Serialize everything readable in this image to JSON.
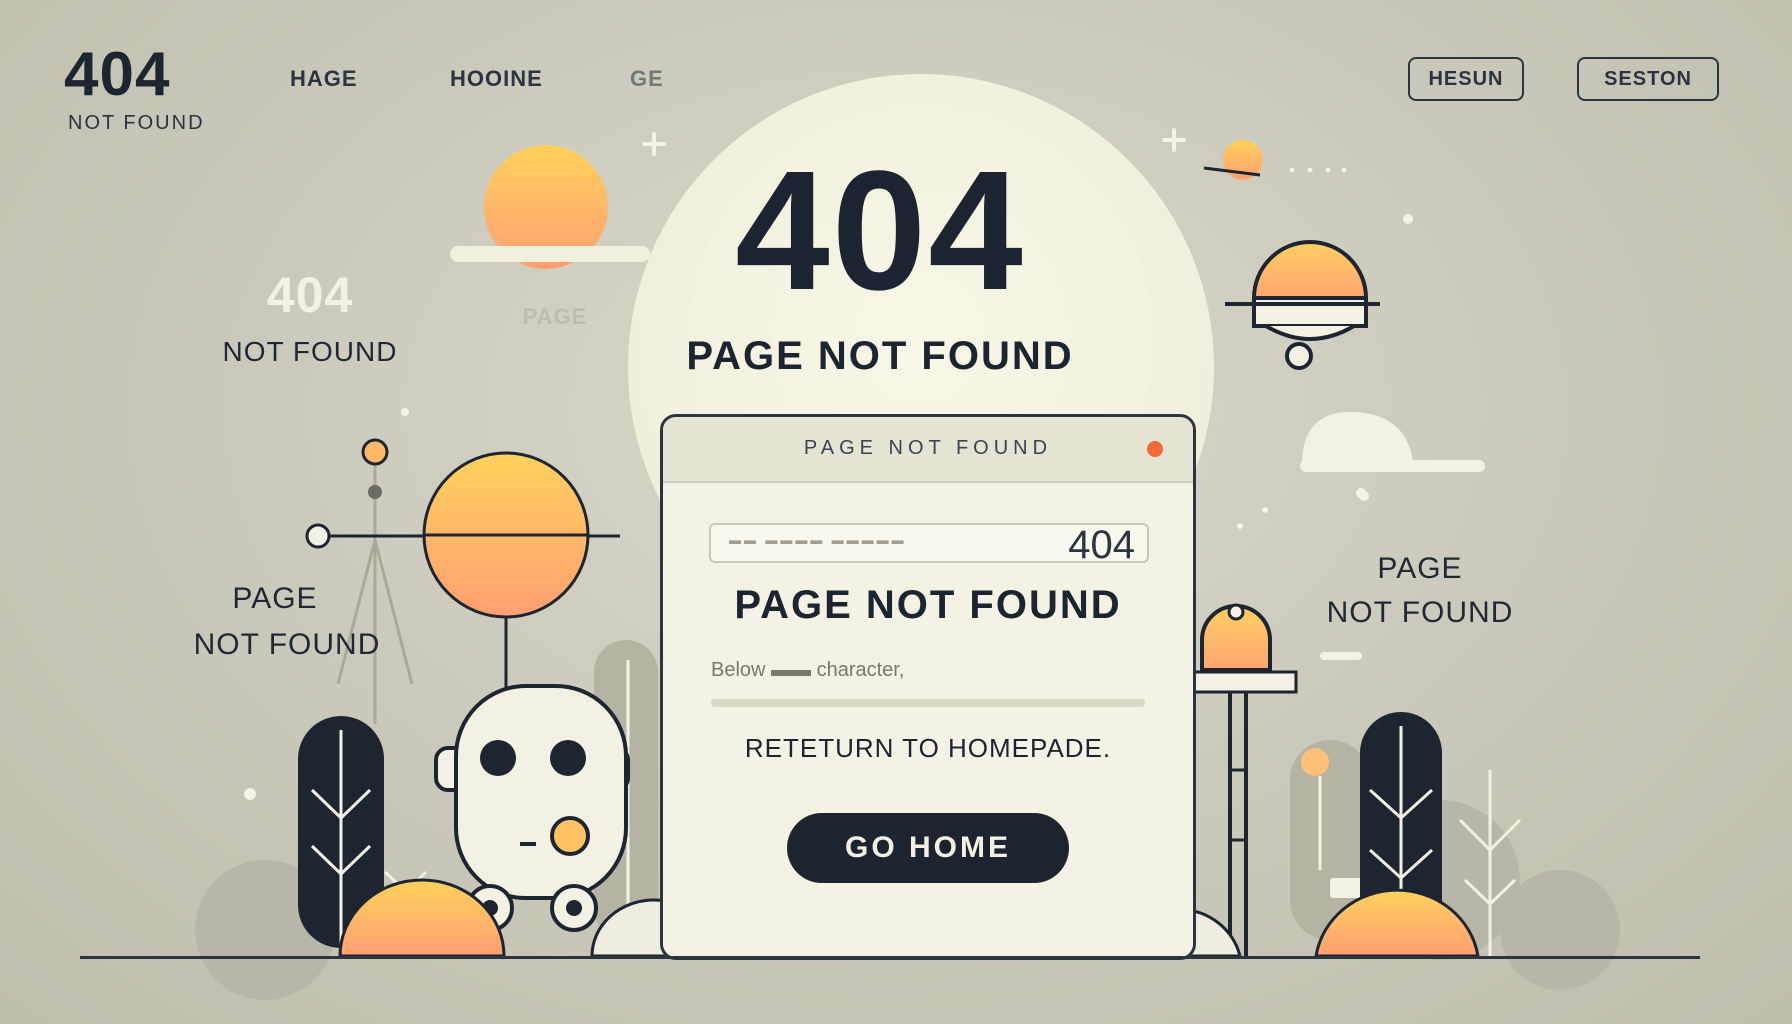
{
  "header": {
    "logo_code": "404",
    "logo_subtitle": "NOT FOUND",
    "nav_links": [
      "HAGE",
      "HOOINE",
      "GE"
    ],
    "buttons": [
      "HESUN",
      "SESTON"
    ]
  },
  "hero": {
    "code": "404",
    "subtitle": "PAGE NOT FOUND"
  },
  "card": {
    "bar_title": "PAGE   NOT FOUND",
    "url_placeholder": "▬▬ ▬▬▬▬ ▬▬▬▬▬",
    "url_value": "404",
    "heading": "PAGE NOT FOUND",
    "body_text": "Below ▬▬ character,",
    "link_text": "RETETURN TO HOMEPADE.",
    "button_label": "GO HOME"
  },
  "left_labels": {
    "code": "404",
    "not_found": "NOT FOUND",
    "faded_page": "PAGE",
    "page": "PAGE",
    "not_found_2": "NOT FOUND"
  },
  "right_labels": {
    "page": "PAGE",
    "not_found": "NOT FOUND"
  },
  "colors": {
    "background": "#c9c8ba",
    "ink": "#1d2530",
    "sun_top": "#ffc94d",
    "sun_bottom": "#ff9f73",
    "card": "#f4f2e4",
    "status_dot": "#f06a3a"
  }
}
